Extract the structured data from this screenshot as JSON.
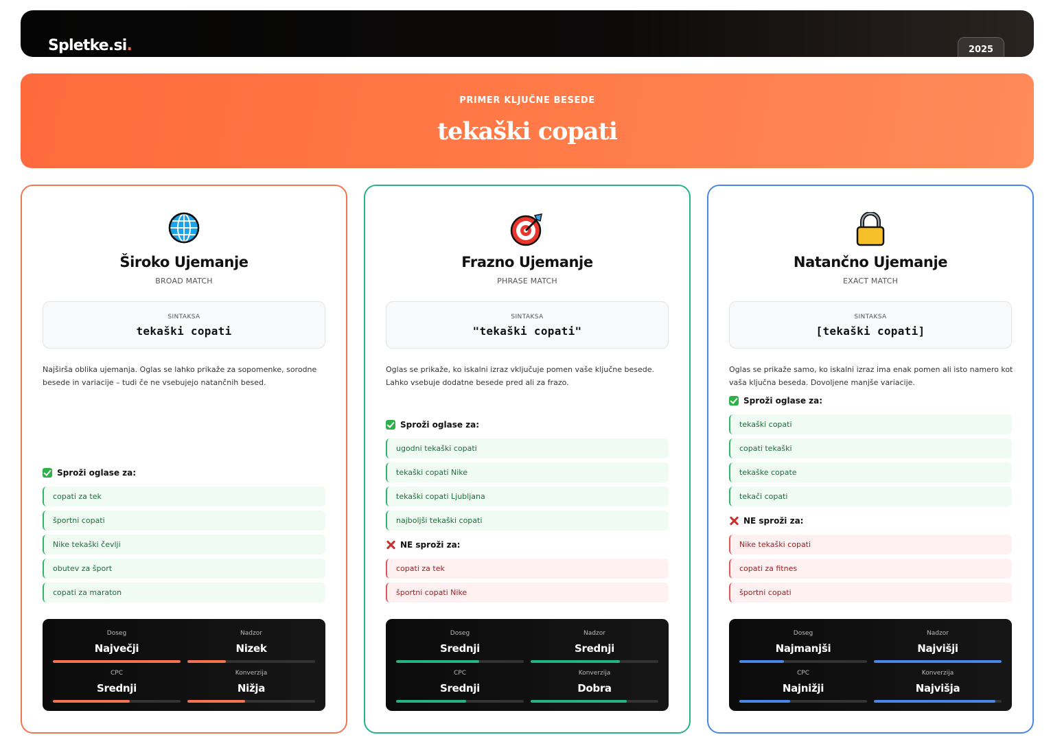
{
  "header": {
    "logo_text": "Spletke.si",
    "logo_dot": ".",
    "year": "2025"
  },
  "hero": {
    "eyebrow": "PRIMER KLJUČNE BESEDE",
    "keyword": "tekaški copati"
  },
  "labels": {
    "syntax": "SINTAKSA",
    "triggers": "Sproži oglase za:",
    "not_triggers": "NE sproži za:"
  },
  "cards": [
    {
      "key": "broad",
      "icon": "globe-icon",
      "accent": "#f47350",
      "title": "Široko Ujemanje",
      "subtitle": "BROAD MATCH",
      "syntax": "tekaški copati",
      "description": "Najširša oblika ujemanja. Oglas se lahko prikaže za sopomenke, sorodne besede in variacije – tudi če ne vsebujejo natančnih besed.",
      "triggers": [
        "copati za tek",
        "športni copati",
        "Nike tekaški čevlji",
        "obutev za šport",
        "copati za maraton"
      ],
      "not_triggers": [],
      "stats": [
        {
          "label": "Doseg",
          "value": "Največji",
          "level": 1.0
        },
        {
          "label": "Nadzor",
          "value": "Nizek",
          "level": 0.3
        },
        {
          "label": "CPC",
          "value": "Srednji",
          "level": 0.6
        },
        {
          "label": "Konverzija",
          "value": "Nižja",
          "level": 0.45
        }
      ]
    },
    {
      "key": "phrase",
      "icon": "target-icon",
      "accent": "#26b383",
      "title": "Frazno Ujemanje",
      "subtitle": "PHRASE MATCH",
      "syntax": "\"tekaški copati\"",
      "description": "Oglas se prikaže, ko iskalni izraz vključuje pomen vaše ključne besede. Lahko vsebuje dodatne besede pred ali za frazo.",
      "triggers": [
        "ugodni tekaški copati",
        "tekaški copati Nike",
        "tekaški copati Ljubljana",
        "najboljši tekaški copati"
      ],
      "not_triggers": [
        "copati za tek",
        "športni copati Nike"
      ],
      "stats": [
        {
          "label": "Doseg",
          "value": "Srednji",
          "level": 0.65
        },
        {
          "label": "Nadzor",
          "value": "Srednji",
          "level": 0.7
        },
        {
          "label": "CPC",
          "value": "Srednji",
          "level": 0.55
        },
        {
          "label": "Konverzija",
          "value": "Dobra",
          "level": 0.75
        }
      ]
    },
    {
      "key": "exact",
      "icon": "lock-icon",
      "accent": "#4b86e6",
      "title": "Natančno Ujemanje",
      "subtitle": "EXACT MATCH",
      "syntax": "[tekaški copati]",
      "description": "Oglas se prikaže samo, ko iskalni izraz ima enak pomen ali isto namero kot vaša ključna beseda. Dovoljene manjše variacije.",
      "triggers": [
        "tekaški copati",
        "copati tekaški",
        "tekaške copate",
        "tekači copati"
      ],
      "not_triggers": [
        "Nike tekaški copati",
        "copati za fitnes",
        "športni copati"
      ],
      "stats": [
        {
          "label": "Doseg",
          "value": "Najmanjši",
          "level": 0.35
        },
        {
          "label": "Nadzor",
          "value": "Najvišji",
          "level": 1.0
        },
        {
          "label": "CPC",
          "value": "Najnižji",
          "level": 0.4
        },
        {
          "label": "Konverzija",
          "value": "Najvišja",
          "level": 0.95
        }
      ]
    }
  ]
}
